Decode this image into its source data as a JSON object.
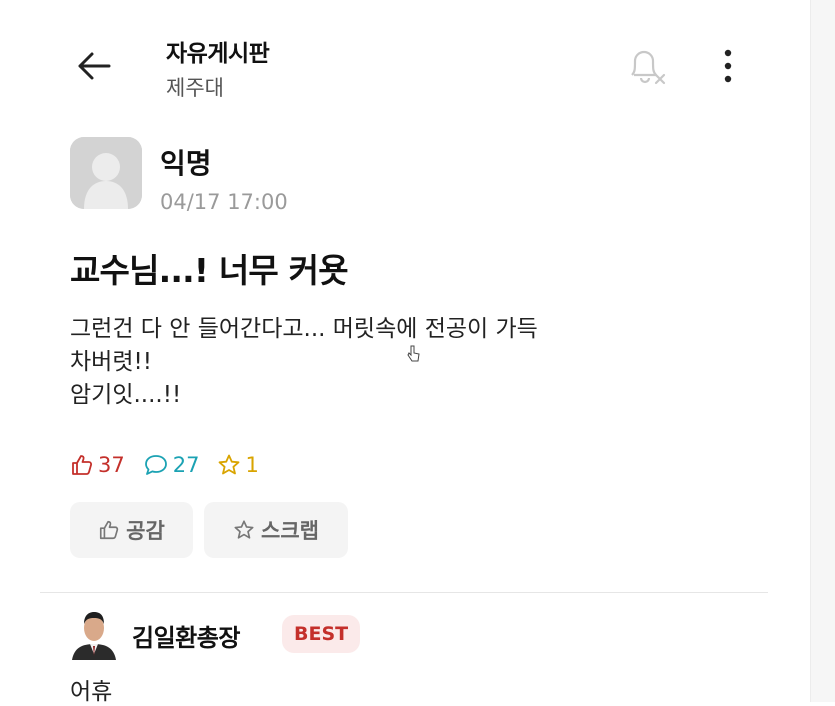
{
  "header": {
    "title": "자유게시판",
    "subtitle": "제주대",
    "back_icon": "arrow-left-icon",
    "bell_icon": "bell-off-icon",
    "more_icon": "more-vertical-icon"
  },
  "post": {
    "author": "익명",
    "time": "04/17 17:00",
    "title": "교수님...! 너무 커욧",
    "body_lines": [
      "그런건 다 안 들어간다고... 머릿속에 전공이 가득",
      "차버렷!!",
      "암기잇....!!"
    ],
    "stats": {
      "likes": "37",
      "comments": "27",
      "scraps": "1"
    }
  },
  "actions": {
    "like_label": "공감",
    "scrap_label": "스크랩"
  },
  "comment": {
    "author": "김일환총장",
    "badge": "BEST",
    "text": "어휴"
  },
  "colors": {
    "like": "#c4302b",
    "comment": "#1ba2b3",
    "scrap": "#d9a400",
    "best_bg": "#fbeaea"
  }
}
